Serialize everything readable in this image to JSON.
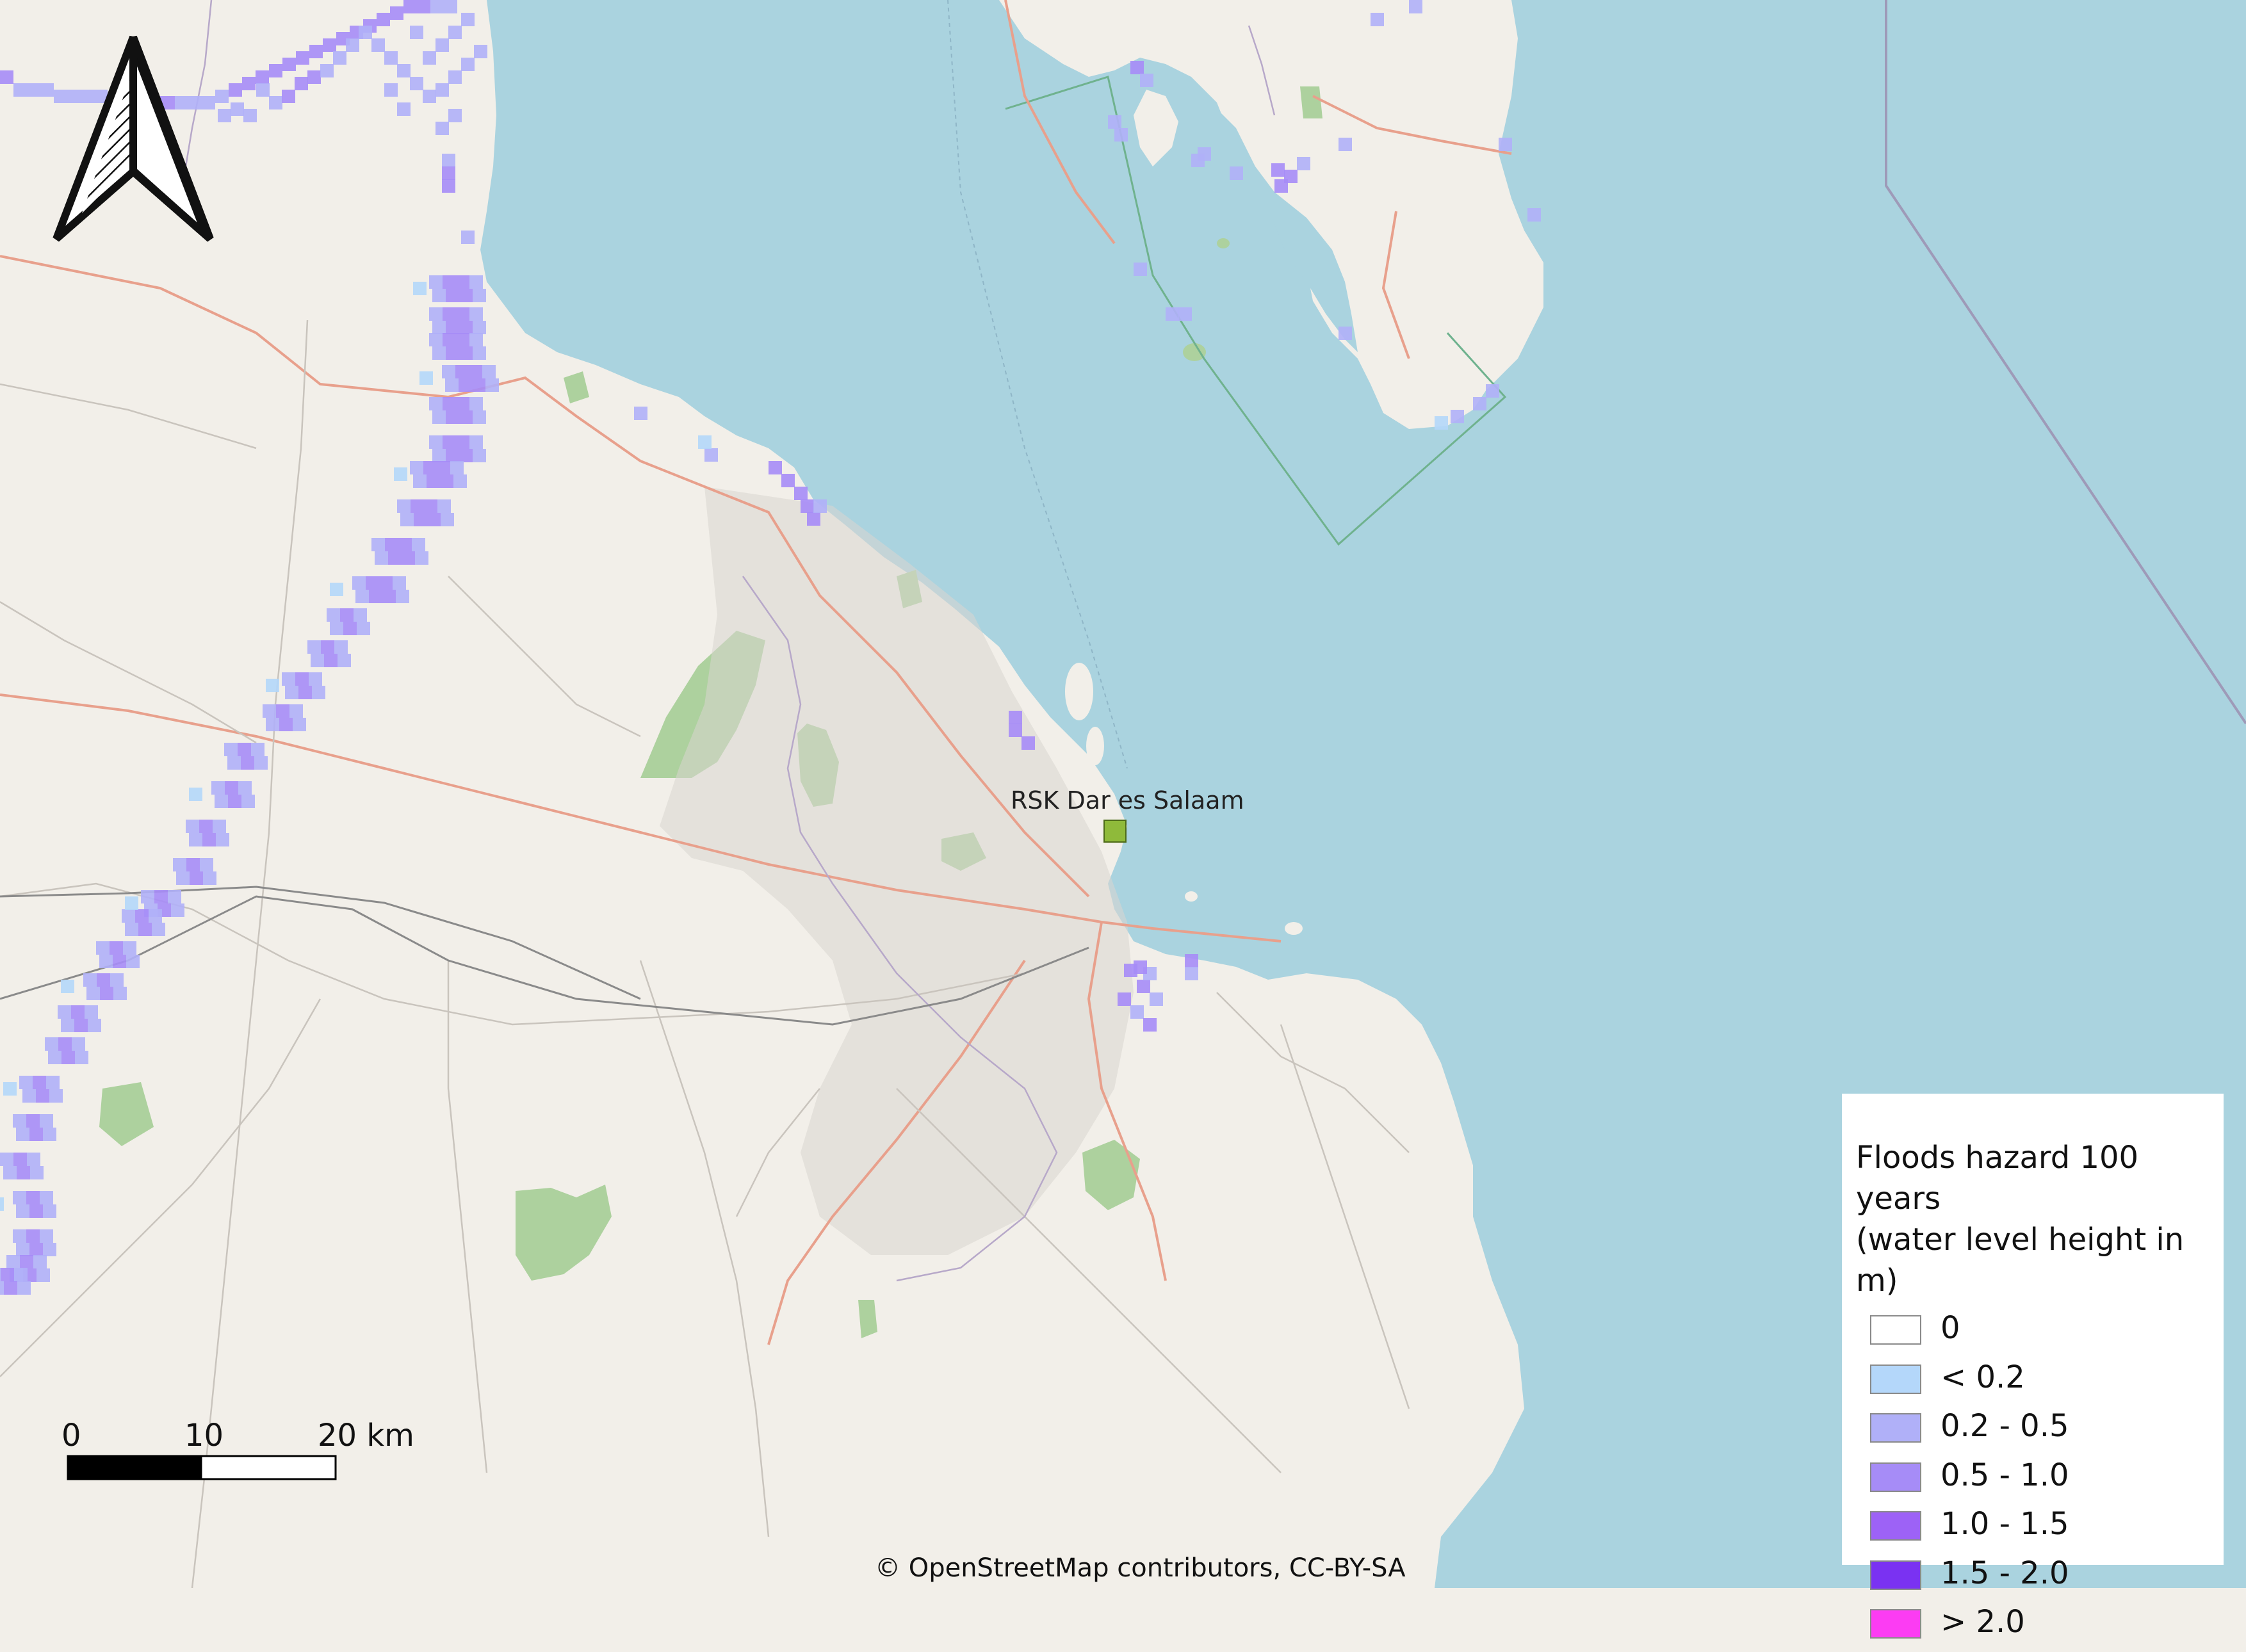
{
  "map": {
    "basemap": "OpenStreetMap",
    "colors": {
      "land": "#f2efe9",
      "water": "#aad3df",
      "forest": "#add19e",
      "road_major": "#e8a08c",
      "road_minor": "#c9c4bd",
      "boundary": "#9e9ab8",
      "marine_park": "#6fb28e"
    }
  },
  "site": {
    "label": "RSK Dar es Salaam",
    "marker_color": "#8fba3a"
  },
  "legend": {
    "title": "Floods hazard 100 years\n(water level height in m)",
    "classes": [
      {
        "label": "0",
        "color": "#ffffff"
      },
      {
        "label": "< 0.2",
        "color": "#b4d7fa"
      },
      {
        "label": "0.2 - 0.5",
        "color": "#b0b0f8"
      },
      {
        "label": "0.5 - 1.0",
        "color": "#a68cf7"
      },
      {
        "label": "1.0 - 1.5",
        "color": "#9d62f6"
      },
      {
        "label": "1.5 - 2.0",
        "color": "#7a32f2"
      },
      {
        "label": "> 2.0",
        "color": "#fc3cf3"
      }
    ]
  },
  "scalebar": {
    "labels": [
      "0",
      "10",
      "20 km"
    ]
  },
  "north_arrow": {
    "icon": "north-arrow-icon"
  },
  "attribution": "© OpenStreetMap contributors, CC-BY-SA"
}
